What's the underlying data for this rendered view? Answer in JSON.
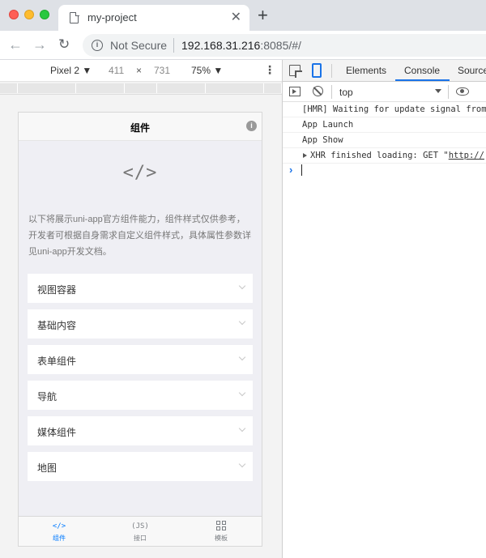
{
  "browser": {
    "tab_title": "my-project",
    "tab_close": "✕",
    "new_tab": "+",
    "security_label": "Not Secure",
    "url_host": "192.168.31.216",
    "url_rest": ":8085/#/"
  },
  "device_toolbar": {
    "device": "Pixel 2 ▼",
    "width": "411",
    "times": "×",
    "height": "731",
    "zoom": "75% ▼"
  },
  "app": {
    "nav_title": "组件",
    "intro": "以下将展示uni-app官方组件能力，组件样式仅供参考，开发者可根据自身需求自定义组件样式，具体属性参数详见uni-app开发文档。",
    "code_glyph": "</>",
    "menu_items": [
      "视图容器",
      "基础内容",
      "表单组件",
      "导航",
      "媒体组件",
      "地图"
    ],
    "tabbar": [
      {
        "icon": "</>",
        "label": "组件",
        "active": true
      },
      {
        "icon": "(JS)",
        "label": "接口",
        "active": false
      },
      {
        "icon": "grid",
        "label": "模板",
        "active": false
      }
    ],
    "accent_color": "#007aff"
  },
  "devtools": {
    "tabs": [
      "Elements",
      "Console",
      "Sources"
    ],
    "active_tab": "Console",
    "context": "top",
    "console": [
      {
        "text": "[HMR] Waiting for update signal from WDS..."
      },
      {
        "text": "App Launch"
      },
      {
        "text": "App Show"
      },
      {
        "text": "XHR finished loading: GET \"",
        "link": "http://",
        "expandable": true
      }
    ],
    "prompt": "›"
  }
}
